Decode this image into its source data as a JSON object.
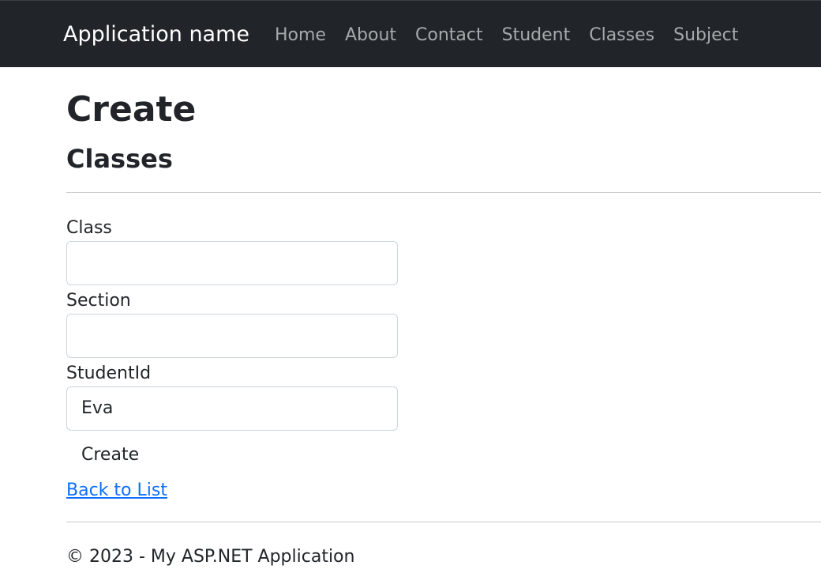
{
  "navbar": {
    "brand": "Application name",
    "links": [
      "Home",
      "About",
      "Contact",
      "Student",
      "Classes",
      "Subject"
    ]
  },
  "page": {
    "title": "Create",
    "subtitle": "Classes"
  },
  "form": {
    "class_label": "Class",
    "class_value": "",
    "section_label": "Section",
    "section_value": "",
    "studentid_label": "StudentId",
    "studentid_value": "Eva",
    "submit_label": "Create"
  },
  "back_link": "Back to List",
  "footer": "© 2023 - My ASP.NET Application"
}
